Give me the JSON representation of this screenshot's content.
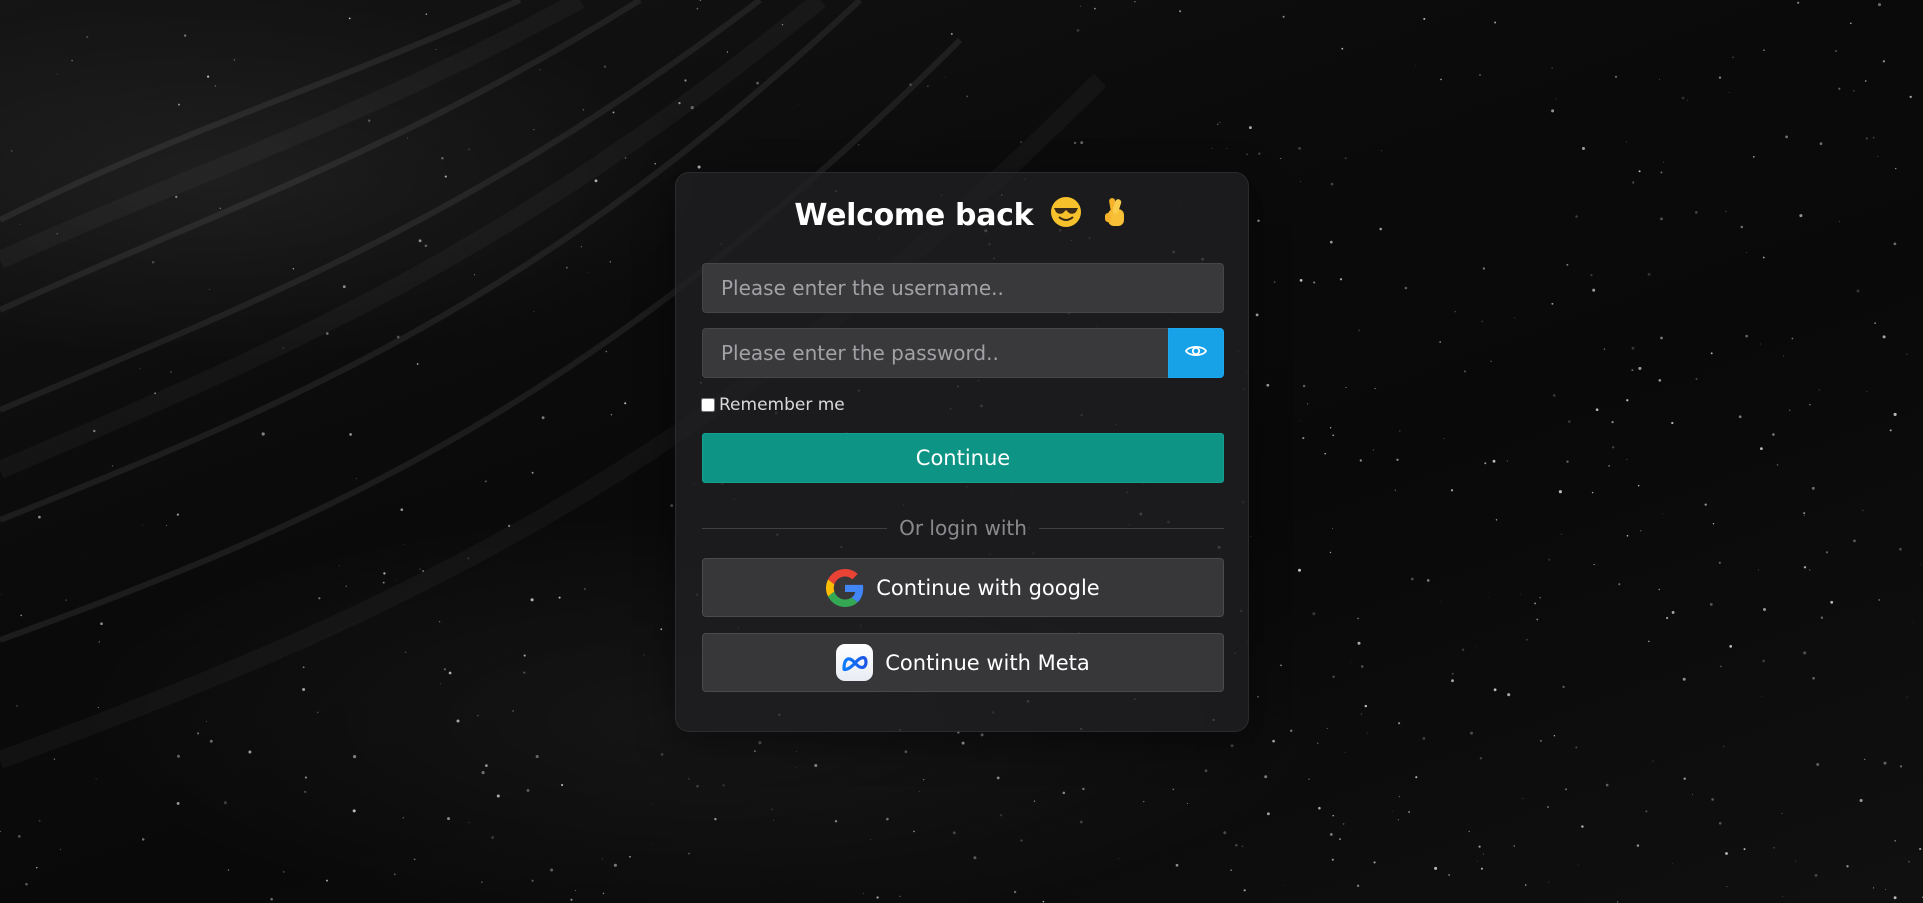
{
  "login": {
    "title": "Welcome back",
    "username_placeholder": "Please enter the username..",
    "password_placeholder": "Please enter the password..",
    "remember_label": "Remember me",
    "continue_label": "Continue",
    "divider_text": "Or login with",
    "google_label": "Continue with google",
    "meta_label": "Continue with Meta"
  },
  "icons": {
    "title_emojis": [
      "smiling-face-with-sunglasses-emoji",
      "crossed-fingers-emoji"
    ],
    "password_toggle": "eye-icon",
    "google": "google-logo-icon",
    "meta": "meta-logo-icon"
  },
  "colors": {
    "accent_teal": "#0e9485",
    "accent_blue": "#17a2e8",
    "card_bg": "#202022",
    "field_bg": "#39393b"
  }
}
